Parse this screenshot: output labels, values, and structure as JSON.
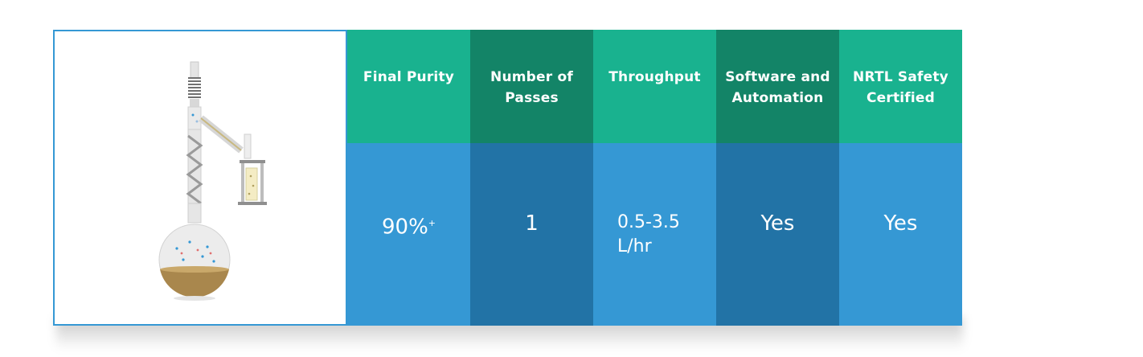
{
  "illustration": "distillation-apparatus",
  "colors": {
    "header_light": "#19b28f",
    "header_dark": "#138467",
    "body_light": "#3598d4",
    "body_dark": "#2273a6"
  },
  "columns": [
    {
      "header": "Final Purity",
      "value": "90%",
      "value_sup": "+"
    },
    {
      "header": "Number of Passes",
      "value": "1"
    },
    {
      "header": "Throughput",
      "value_line1": "0.5-3.5",
      "value_line2": "L/hr"
    },
    {
      "header": "Software and Automation",
      "value": "Yes"
    },
    {
      "header": "NRTL Safety Certified",
      "value": "Yes"
    }
  ]
}
